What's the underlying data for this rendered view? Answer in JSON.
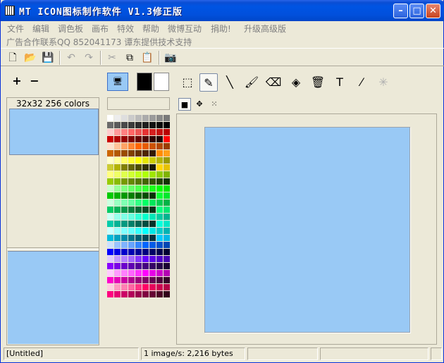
{
  "window": {
    "title": "MT ICON图标制作软件  V1.3修正版",
    "minimize_glyph": "–",
    "maximize_glyph": "□",
    "close_glyph": "✕"
  },
  "menu": [
    "文件",
    "编辑",
    "调色板",
    "画布",
    "特效",
    "帮助",
    "微博互动",
    "捐助!",
    "升级高级版"
  ],
  "ad_text": "广告合作联系QQ 852041173 谭东提供技术支持",
  "toolbar": {
    "icons": [
      {
        "name": "new-file-icon",
        "glyph": "🗋",
        "enabled": true
      },
      {
        "name": "open-folder-icon",
        "glyph": "📂",
        "enabled": true
      },
      {
        "name": "save-icon",
        "glyph": "💾",
        "enabled": true
      },
      {
        "name": "undo-icon",
        "glyph": "↶",
        "enabled": false
      },
      {
        "name": "redo-icon",
        "glyph": "↷",
        "enabled": false
      },
      {
        "name": "cut-icon",
        "glyph": "✂",
        "enabled": false
      },
      {
        "name": "copy-icon",
        "glyph": "⧉",
        "enabled": true
      },
      {
        "name": "paste-icon",
        "glyph": "📋",
        "enabled": false
      },
      {
        "name": "camera-icon",
        "glyph": "📷",
        "enabled": true
      }
    ]
  },
  "left_panel": {
    "add_glyph": "+",
    "remove_glyph": "−",
    "size_label": "32x32 256 colors",
    "preview_color": "#99c9f5"
  },
  "colors": {
    "foreground": "#000000",
    "background": "#ffffff",
    "mode_glyph": "🖥"
  },
  "palette": [
    "#ffffff",
    "#ececec",
    "#dedede",
    "#cbcbcb",
    "#bababa",
    "#ababab",
    "#9b9b9b",
    "#8a8a8a",
    "#797979",
    "#6b6b6b",
    "#5b5b5b",
    "#4a4a4a",
    "#3b3b3b",
    "#2c2c2c",
    "#1e1e1e",
    "#111111",
    "#080808",
    "#000000",
    "#ffcccc",
    "#ff9999",
    "#ff8080",
    "#ff6666",
    "#ee5555",
    "#e63333",
    "#d62020",
    "#c71010",
    "#b80000",
    "#cc0000",
    "#b20000",
    "#990000",
    "#800000",
    "#660000",
    "#4c0000",
    "#330000",
    "#1f0000",
    "#ff0000",
    "#ffe0cc",
    "#ffc299",
    "#ffa366",
    "#ff8533",
    "#ff6600",
    "#e65c00",
    "#cc5200",
    "#b34700",
    "#993d00",
    "#cc6600",
    "#b35900",
    "#994c00",
    "#804000",
    "#663300",
    "#4d2600",
    "#331a00",
    "#ff8c00",
    "#ff9f1a",
    "#ffffcc",
    "#ffff99",
    "#ffff66",
    "#ffff33",
    "#ffff00",
    "#e6e600",
    "#cccc00",
    "#b3b300",
    "#999900",
    "#cccc33",
    "#b3b300",
    "#808000",
    "#666600",
    "#4d4d00",
    "#333300",
    "#1a1a00",
    "#ffd700",
    "#e6c200",
    "#ffff80",
    "#f0ff66",
    "#e0ff4d",
    "#d0ff33",
    "#c0ff1a",
    "#b0ff00",
    "#a0e600",
    "#90cc00",
    "#80b300",
    "#99cc00",
    "#88bb00",
    "#779900",
    "#668800",
    "#557700",
    "#446600",
    "#335500",
    "#224400",
    "#113300",
    "#ccffcc",
    "#99ff99",
    "#80ff80",
    "#66ff66",
    "#4dff4d",
    "#33ff33",
    "#1aff1a",
    "#00ff00",
    "#00e600",
    "#00cc00",
    "#00b300",
    "#009900",
    "#008000",
    "#006600",
    "#004d00",
    "#003300",
    "#00ff33",
    "#00e62e",
    "#ccffe0",
    "#99ffc2",
    "#80ffb3",
    "#66ffa3",
    "#33ff85",
    "#00ff66",
    "#00e65c",
    "#00cc52",
    "#00b347",
    "#00cc66",
    "#00b359",
    "#00994c",
    "#008040",
    "#006633",
    "#004d26",
    "#00331a",
    "#00ff80",
    "#00e673",
    "#ccfff5",
    "#99ffeb",
    "#80ffe6",
    "#66ffe0",
    "#33ffd6",
    "#00ffcc",
    "#00e6b8",
    "#00cca3",
    "#00b38f",
    "#00ccaa",
    "#00b395",
    "#009980",
    "#00806a",
    "#006655",
    "#004d40",
    "#00332b",
    "#00ffdd",
    "#00e6c8",
    "#ccffff",
    "#99ffff",
    "#80ffff",
    "#66ffff",
    "#33ffff",
    "#00ffff",
    "#00e6e6",
    "#00cccc",
    "#00b3b3",
    "#00bbdd",
    "#00a3c2",
    "#008ca8",
    "#00758c",
    "#005f73",
    "#004859",
    "#00323f",
    "#00ccff",
    "#00b8e6",
    "#cce0ff",
    "#99c2ff",
    "#80b3ff",
    "#66a3ff",
    "#3385ff",
    "#0066ff",
    "#005ce6",
    "#0052cc",
    "#0047b3",
    "#0000ff",
    "#0000e6",
    "#0000cc",
    "#0000b3",
    "#000099",
    "#000080",
    "#000066",
    "#00004d",
    "#000033",
    "#e0ccff",
    "#c299ff",
    "#b380ff",
    "#a366ff",
    "#8533ff",
    "#6600ff",
    "#5c00e6",
    "#5200cc",
    "#4700b3",
    "#8800ff",
    "#7a00e6",
    "#6c00cc",
    "#5f00b3",
    "#510099",
    "#440080",
    "#360066",
    "#28004d",
    "#1b0033",
    "#ffccff",
    "#ff99ff",
    "#ff80ff",
    "#ff66ff",
    "#ff33ff",
    "#ff00ff",
    "#e600e6",
    "#cc00cc",
    "#b300b3",
    "#ff00cc",
    "#e600b8",
    "#cc00a3",
    "#b3008f",
    "#99007a",
    "#800066",
    "#660052",
    "#4d003d",
    "#330029",
    "#ffcce0",
    "#ff99c2",
    "#ff80b3",
    "#ff66a3",
    "#ff3385",
    "#ff0066",
    "#e6005c",
    "#cc0052",
    "#b30047",
    "#ff0080",
    "#e60073",
    "#cc0066",
    "#b30059",
    "#99004d",
    "#800040",
    "#660033",
    "#4d0026",
    "#33001a"
  ],
  "drawing_tools": [
    {
      "name": "selection-tool-icon",
      "glyph": "⬚",
      "active": false,
      "enabled": true
    },
    {
      "name": "pencil-tool-icon",
      "glyph": "✎",
      "active": true,
      "enabled": true
    },
    {
      "name": "line-tool-icon",
      "glyph": "╲",
      "active": false,
      "enabled": true
    },
    {
      "name": "brush-tool-icon",
      "glyph": "🖌",
      "active": false,
      "enabled": true
    },
    {
      "name": "eraser-tool-icon",
      "glyph": "⌫",
      "active": false,
      "enabled": true
    },
    {
      "name": "fill-tool-icon",
      "glyph": "◈",
      "active": false,
      "enabled": true
    },
    {
      "name": "bucket-tool-icon",
      "glyph": "🗑",
      "active": false,
      "enabled": true
    },
    {
      "name": "text-tool-icon",
      "glyph": "T",
      "active": false,
      "enabled": true
    },
    {
      "name": "eyedropper-tool-icon",
      "glyph": "⁄",
      "active": false,
      "enabled": true
    },
    {
      "name": "magic-wand-tool-icon",
      "glyph": "✳",
      "active": false,
      "enabled": false
    }
  ],
  "brush_sizes": [
    {
      "name": "brush-size-1-icon",
      "glyph": "■",
      "active": true
    },
    {
      "name": "brush-size-2-icon",
      "glyph": "✥",
      "active": false
    },
    {
      "name": "brush-size-3-icon",
      "glyph": "⁙",
      "active": false
    }
  ],
  "canvas": {
    "color": "#99c9f5"
  },
  "status": {
    "filename": "[Untitled]",
    "info": "1 image/s: 2,216 bytes",
    "panel3": "",
    "panel4": "",
    "panel5": ""
  }
}
